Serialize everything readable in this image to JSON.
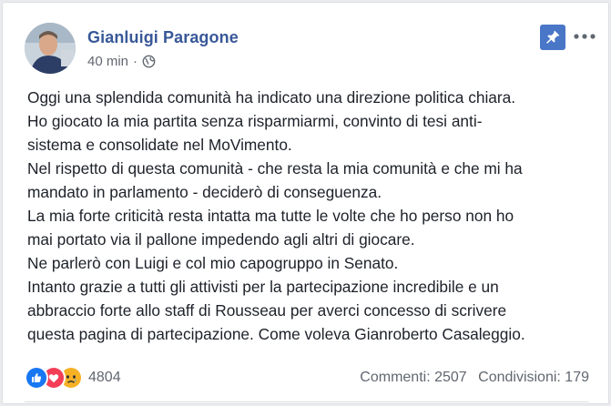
{
  "post": {
    "author": "Gianluigi Paragone",
    "time": "40 min",
    "separator": "·",
    "privacy_icon": "globe-icon",
    "pin_icon": "pin-icon",
    "more_icon": "more-options-icon",
    "text_lines": [
      "Oggi una splendida comunità ha indicato una direzione politica chiara.",
      "Ho giocato la mia partita senza risparmiarmi, convinto di tesi anti-",
      "sistema e consolidate nel MoVimento.",
      "Nel rispetto di questa comunità - che resta la mia comunità e che mi ha",
      "mandato in parlamento - deciderò di conseguenza.",
      "La mia forte criticità resta intatta ma tutte le volte che ho perso non ho",
      "mai portato via il pallone impedendo agli altri di giocare.",
      "Ne parlerò con Luigi e col mio capogruppo in Senato.",
      "Intanto grazie a tutti gli attivisti per la partecipazione incredibile e un",
      "abbraccio forte allo staff di Rousseau per averci concesso di scrivere",
      "questa pagina di partecipazione. Come voleva Gianroberto Casaleggio."
    ]
  },
  "footer": {
    "reactions": [
      "like-icon",
      "love-icon",
      "sad-icon"
    ],
    "reaction_count": "4804",
    "comments": "Commenti: 2507",
    "shares": "Condivisioni: 179"
  },
  "colors": {
    "author": "#385898",
    "pin_bg": "#4a76c7",
    "like": "#1877f2",
    "love": "#f33e58",
    "sad": "#f7b125"
  }
}
